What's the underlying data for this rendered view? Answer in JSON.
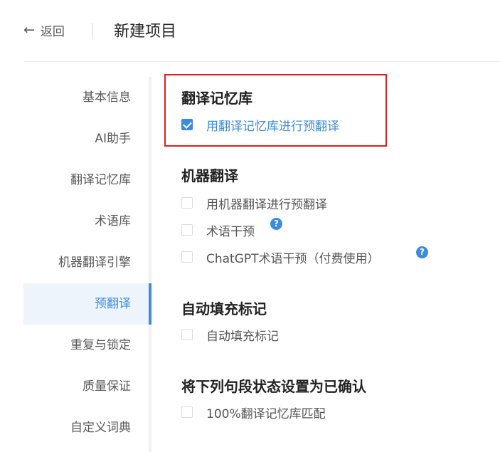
{
  "header": {
    "back_label": "返回",
    "back_icon": "left-arrow-icon",
    "title": "新建项目"
  },
  "sidebar": {
    "items": [
      {
        "label": "基本信息",
        "active": false
      },
      {
        "label": "AI助手",
        "active": false
      },
      {
        "label": "翻译记忆库",
        "active": false
      },
      {
        "label": "术语库",
        "active": false
      },
      {
        "label": "机器翻译引擎",
        "active": false
      },
      {
        "label": "预翻译",
        "active": true
      },
      {
        "label": "重复与锁定",
        "active": false
      },
      {
        "label": "质量保证",
        "active": false
      },
      {
        "label": "自定义词典",
        "active": false
      }
    ]
  },
  "sections": {
    "tm": {
      "title": "翻译记忆库",
      "options": [
        {
          "label": "用翻译记忆库进行预翻译",
          "checked": true
        }
      ]
    },
    "mt": {
      "title": "机器翻译",
      "options": [
        {
          "label": "用机器翻译进行预翻译",
          "checked": false
        },
        {
          "label": "术语干预",
          "checked": false,
          "help_icon": "question-mark-icon"
        },
        {
          "label": "ChatGPT术语干预（付费使用）",
          "checked": false,
          "help_icon": "question-mark-icon"
        }
      ]
    },
    "autofill": {
      "title": "自动填充标记",
      "options": [
        {
          "label": "自动填充标记",
          "checked": false
        }
      ]
    },
    "confirm": {
      "title": "将下列句段状态设置为已确认",
      "options": [
        {
          "label": "100%翻译记忆库匹配",
          "checked": false
        }
      ]
    }
  },
  "help_glyph": "?",
  "colors": {
    "accent": "#3c8cdb",
    "highlight_border": "#e02020"
  }
}
